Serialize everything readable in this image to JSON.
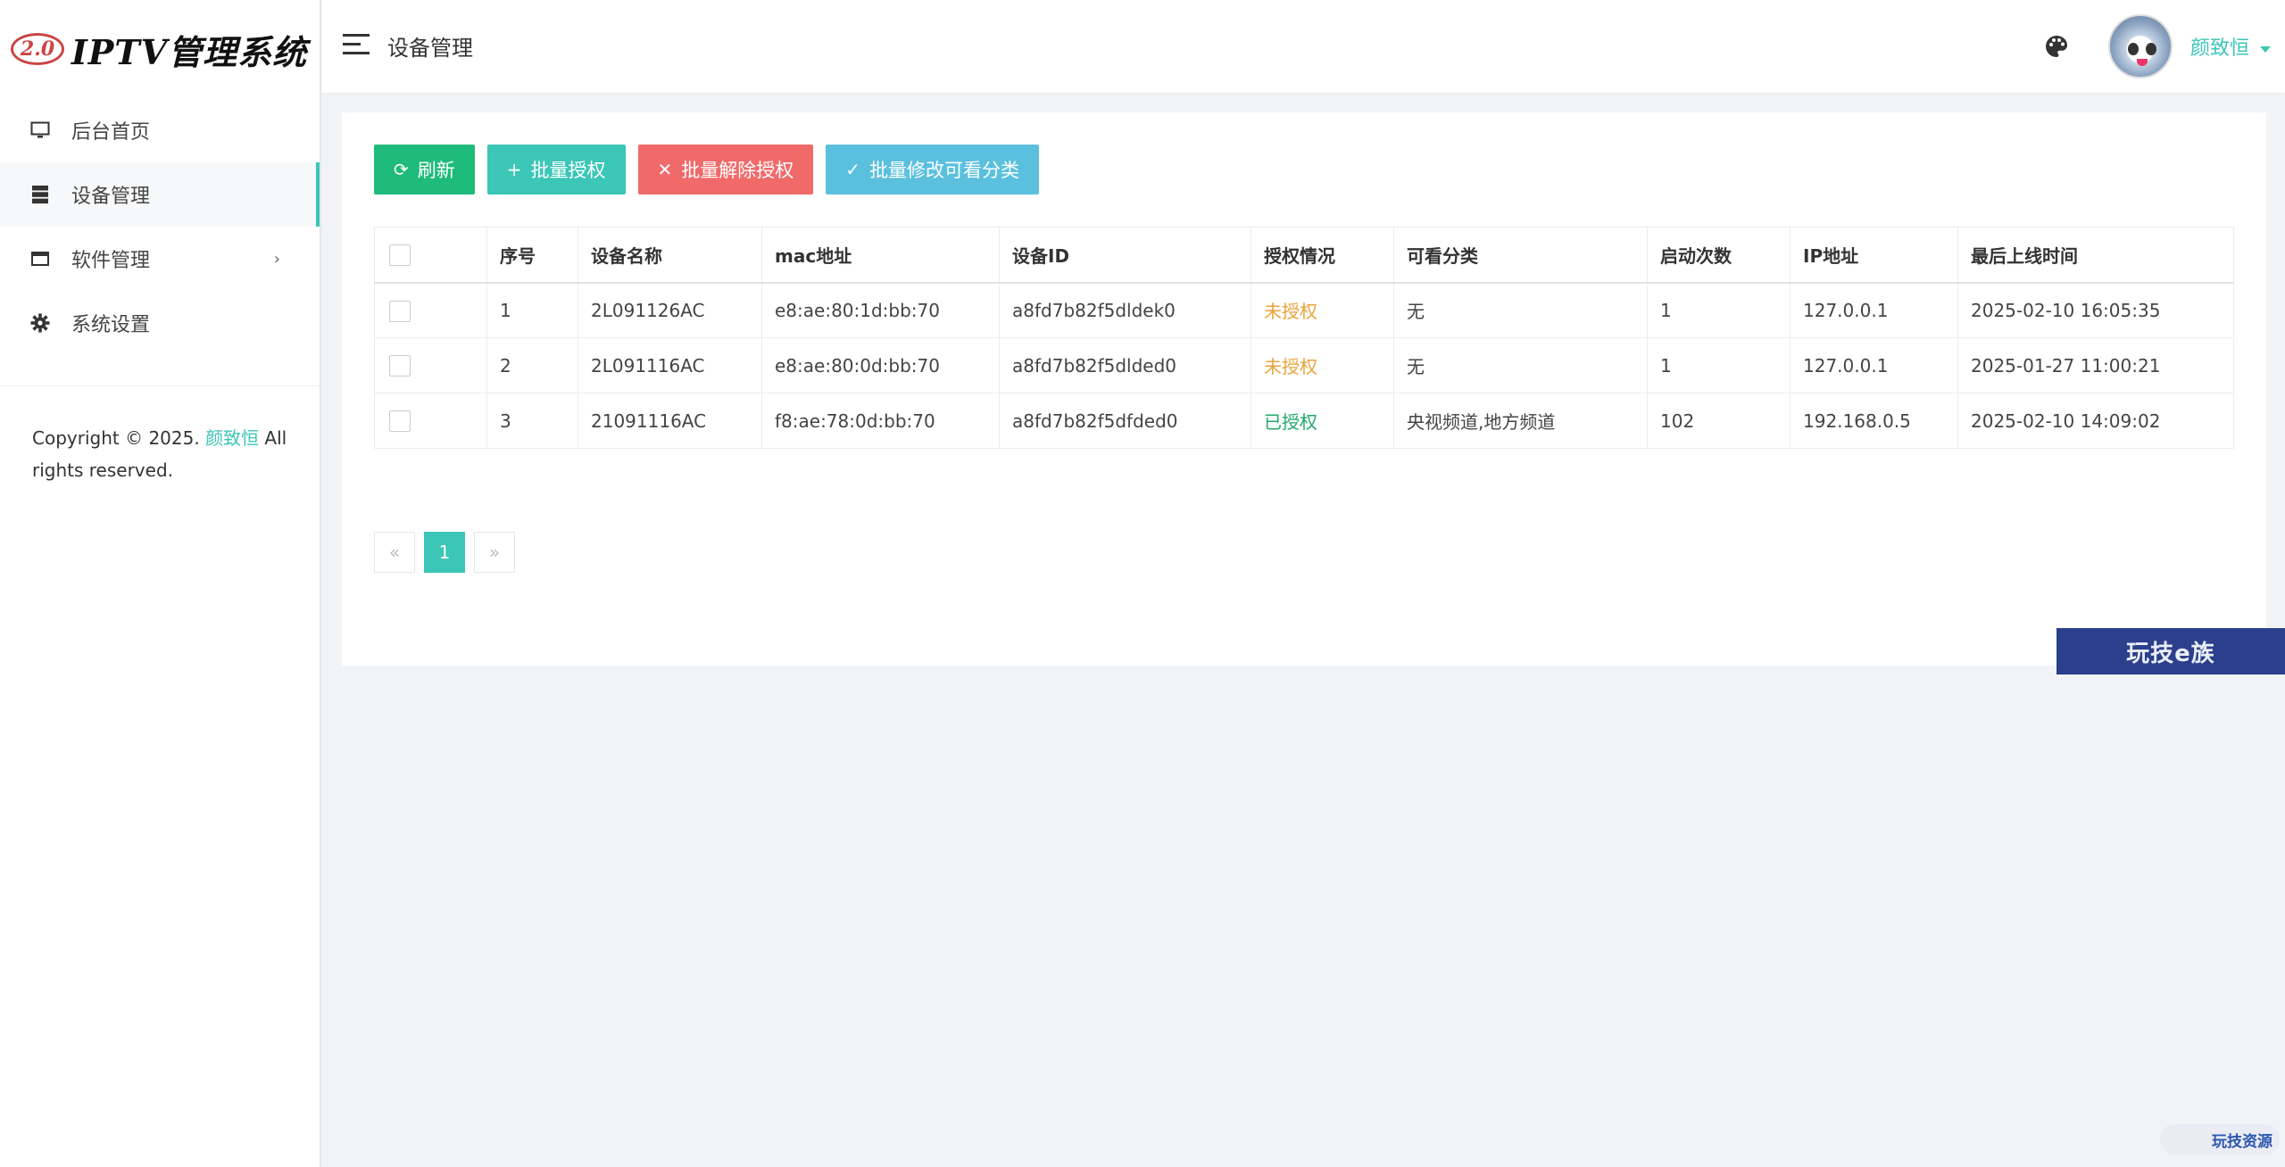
{
  "logo": {
    "badge": "2.0",
    "title": "IPTV管理系统"
  },
  "sidebar": {
    "items": [
      {
        "label": "后台首页",
        "icon": "monitor-icon"
      },
      {
        "label": "设备管理",
        "icon": "server-icon",
        "active": true
      },
      {
        "label": "软件管理",
        "icon": "window-icon",
        "chevron": "›"
      },
      {
        "label": "系统设置",
        "icon": "gear-icon"
      }
    ],
    "copyright_prefix": "Copyright © 2025.",
    "copyright_author": "颜致恒",
    "copyright_suffix": "All rights reserved."
  },
  "header": {
    "page_title": "设备管理",
    "username": "颜致恒"
  },
  "toolbar": {
    "refresh": "刷新",
    "batch_authorize": "批量授权",
    "batch_unauthorize": "批量解除授权",
    "batch_category": "批量修改可看分类"
  },
  "table": {
    "columns": [
      "序号",
      "设备名称",
      "mac地址",
      "设备ID",
      "授权情况",
      "可看分类",
      "启动次数",
      "IP地址",
      "最后上线时间"
    ],
    "rows": [
      [
        "1",
        "2L091126AC",
        "e8:ae:80:1d:bb:70",
        "a8fd7b82f5dldek0",
        "未授权",
        "无",
        "1",
        "127.0.0.1",
        "2025-02-10 16:05:35"
      ],
      [
        "2",
        "2L091116AC",
        "e8:ae:80:0d:bb:70",
        "a8fd7b82f5dlded0",
        "未授权",
        "无",
        "1",
        "127.0.0.1",
        "2025-01-27 11:00:21"
      ],
      [
        "3",
        "21091116AC",
        "f8:ae:78:0d:bb:70",
        "a8fd7b82f5dfded0",
        "已授权",
        "央视频道,地方频道",
        "102",
        "192.168.0.5",
        "2025-02-10 14:09:02"
      ]
    ]
  },
  "pagination": {
    "prev": "«",
    "current": "1",
    "next": "»"
  },
  "watermarks": {
    "banner": "玩技e族",
    "badge": "玩技资源"
  },
  "colors": {
    "accent": "#3cc6b7",
    "green": "#1fbb7a",
    "red": "#f06a6a",
    "cyan": "#5bc0de",
    "unauthorized": "#e8a33a",
    "authorized": "#21a86a"
  }
}
